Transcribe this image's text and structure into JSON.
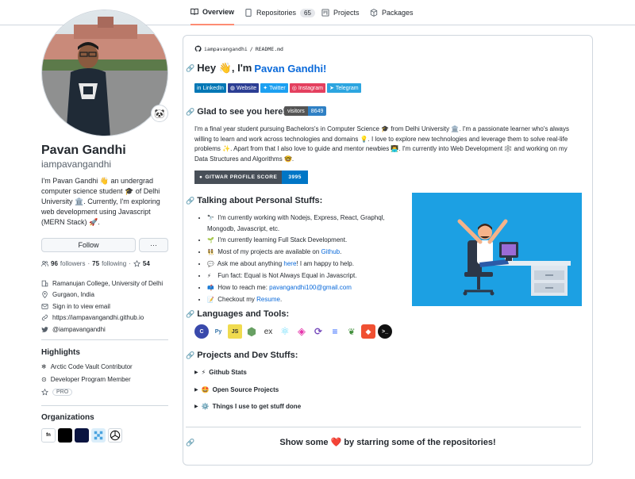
{
  "tabs": [
    {
      "label": "Overview",
      "icon": "book-icon"
    },
    {
      "label": "Repositories",
      "icon": "repo-icon",
      "count": "65"
    },
    {
      "label": "Projects",
      "icon": "project-icon"
    },
    {
      "label": "Packages",
      "icon": "package-icon"
    }
  ],
  "profile": {
    "status_emoji": "🐼",
    "name": "Pavan Gandhi",
    "login": "iampavangandhi",
    "bio": "I'm Pavan Gandhi 👋 an undergrad computer science student 🎓 of Delhi University 🏛️. Currently, I'm exploring web development using Javascript (MERN Stack) 🚀.",
    "follow_label": "Follow",
    "more_label": "···",
    "followers_count": "96",
    "followers_label": "followers",
    "following_count": "75",
    "following_label": "following",
    "stars_count": "54",
    "details": [
      {
        "icon": "organization-icon",
        "text": "Ramanujan College, University of Delhi"
      },
      {
        "icon": "location-icon",
        "text": "Gurgaon, India"
      },
      {
        "icon": "mail-icon",
        "text": "Sign in to view email"
      },
      {
        "icon": "link-icon",
        "text": "https://iampavangandhi.github.io"
      },
      {
        "icon": "twitter-icon",
        "text": "@iampavangandhi"
      }
    ]
  },
  "highlights": {
    "title": "Highlights",
    "items": [
      {
        "icon": "snowflake-icon",
        "text": "Arctic Code Vault Contributor"
      },
      {
        "icon": "developer-icon",
        "text": "Developer Program Member"
      }
    ],
    "pro_label": "PRO"
  },
  "organizations": {
    "title": "Organizations",
    "items": [
      {
        "name": "org-fn",
        "color": "#ffffff",
        "text": "fn"
      },
      {
        "name": "org-dark",
        "color": "#000000",
        "text": ""
      },
      {
        "name": "org-navy",
        "color": "#0a1440",
        "text": ""
      },
      {
        "name": "org-blue",
        "color": "#4aa3df",
        "text": ""
      },
      {
        "name": "org-star",
        "color": "#ffffff",
        "text": ""
      }
    ]
  },
  "readme": {
    "path_user": "iampavangandhi",
    "path_sep": "/",
    "path_file": "README.md",
    "heading_prefix": "Hey 👋, I'm",
    "heading_name": "Pavan Gandhi!",
    "badges": [
      {
        "label": "LinkedIn",
        "color": "#0077b5"
      },
      {
        "label": "Website",
        "color": "#2c3e94"
      },
      {
        "label": "Twitter",
        "color": "#1ca0f1"
      },
      {
        "label": "Instagram",
        "color": "#e4405f"
      },
      {
        "label": "Telegram",
        "color": "#2ca5e0"
      }
    ],
    "glad_heading": "Glad to see you here!",
    "visitors_label": "visitors",
    "visitors_count": "8649",
    "intro": "I'm a final year student pursuing Bachelors's in Computer Science 🎓 from Delhi University 🏛️. I'm a passionate learner who's always willing to learn and work across technologies and domains 💡. I love to explore new technologies and leverage them to solve real-life problems ✨. Apart from that I also love to guide and mentor newbies 👨‍💻. I'm currently into Web Development 🕸️ and working on my Data Structures and Algorithms 🤓.",
    "score_label": "GITWAR PROFILE SCORE",
    "score_value": "3995",
    "talking_heading": "Talking about Personal Stuffs:",
    "stuffs": [
      {
        "emoji": "🔭",
        "text": "I'm currently working with Nodejs, Express, React, Graphql, Mongodb, Javascript, etc."
      },
      {
        "emoji": "🌱",
        "text": "I'm currently learning Full Stack Development."
      },
      {
        "emoji": "👯",
        "text": "Most of my projects are available on",
        "link": "Github",
        "after": "."
      },
      {
        "emoji": "💬",
        "text": "Ask me about anything",
        "link": "here",
        "after": "! I am happy to help."
      },
      {
        "emoji": "⚡",
        "text": "Fun fact: Equal is Not Always Equal in Javascript."
      },
      {
        "emoji": "📫",
        "text": "How to reach me:",
        "link": "pavangandhi100@gmail.com",
        "after": ""
      },
      {
        "emoji": "📝",
        "text": "Checkout my",
        "link": "Resume",
        "after": "."
      }
    ],
    "languages_heading": "Languages and Tools:",
    "tools": [
      {
        "name": "c-icon",
        "color": "#3949ab",
        "glyph": "C"
      },
      {
        "name": "python-icon",
        "color": "#3776ab",
        "glyph": "Py"
      },
      {
        "name": "javascript-icon",
        "color": "#f0db4f",
        "glyph": "JS"
      },
      {
        "name": "nodejs-icon",
        "color": "#68a063",
        "glyph": "⬢"
      },
      {
        "name": "express-icon",
        "color": "#ffffff",
        "glyph": "ex"
      },
      {
        "name": "react-icon",
        "color": "#ffffff",
        "glyph": "⚛"
      },
      {
        "name": "graphql-icon",
        "color": "#ffffff",
        "glyph": "◈"
      },
      {
        "name": "redux-icon",
        "color": "#ffffff",
        "glyph": "⟳"
      },
      {
        "name": "database-icon",
        "color": "#2962ff",
        "glyph": "≡"
      },
      {
        "name": "mongodb-icon",
        "color": "#3f8e3a",
        "glyph": "❦"
      },
      {
        "name": "git-icon",
        "color": "#f05032",
        "glyph": "◆"
      },
      {
        "name": "terminal-icon",
        "color": "#111111",
        "glyph": ">_"
      }
    ],
    "projects_heading": "Projects and Dev Stuffs:",
    "summaries": [
      {
        "emoji": "⚡",
        "text": "Github Stats"
      },
      {
        "emoji": "🤩",
        "text": "Open Source Projects"
      },
      {
        "emoji": "⚙️",
        "text": "Things I use to get stuff done"
      }
    ],
    "show_prefix": "Show some",
    "show_heart": "❤️",
    "show_suffix": "by starring some of the repositories!"
  }
}
